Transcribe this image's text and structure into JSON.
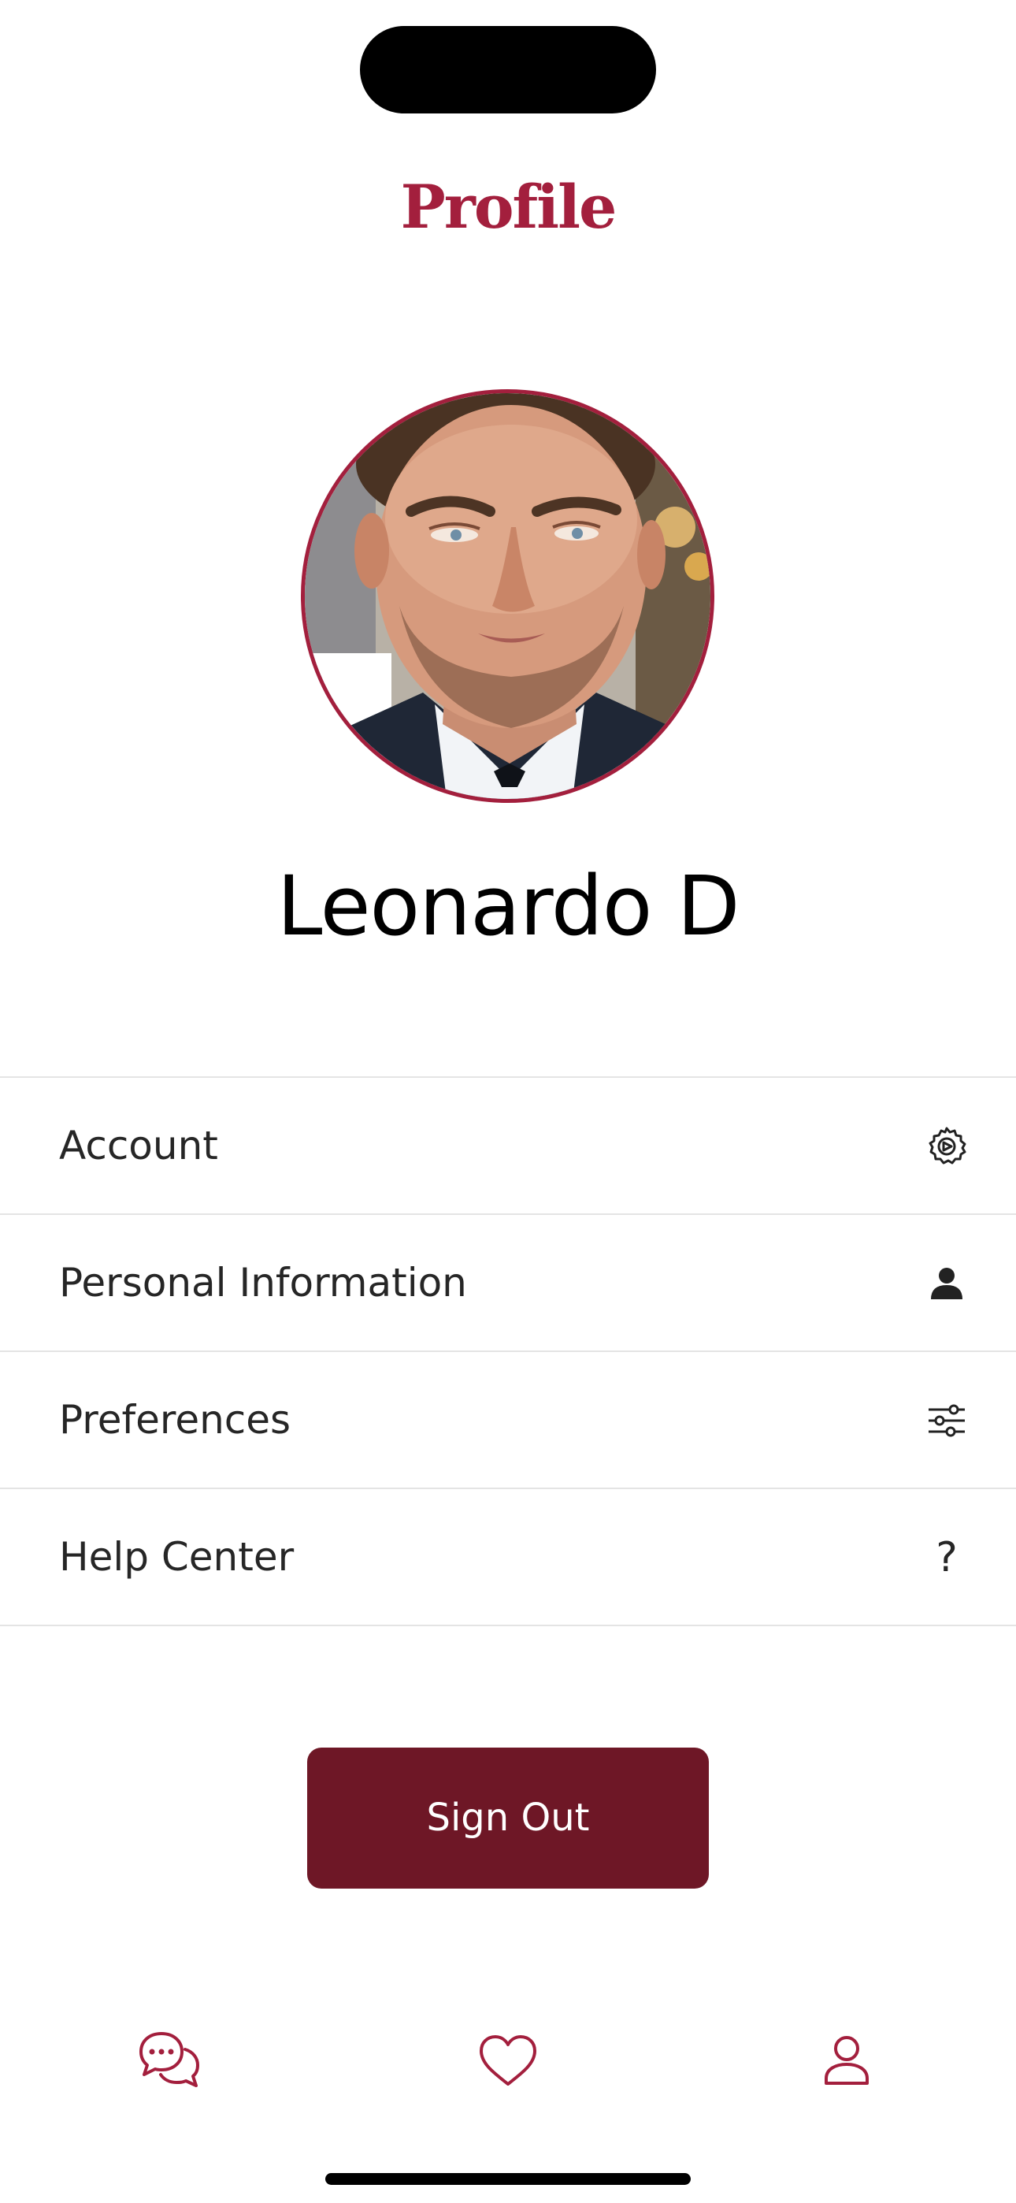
{
  "header": {
    "title": "Profile"
  },
  "profile": {
    "name": "Leonardo D"
  },
  "menu": {
    "items": [
      {
        "label": "Account",
        "icon": "gear-icon"
      },
      {
        "label": "Personal Information",
        "icon": "person-icon"
      },
      {
        "label": "Preferences",
        "icon": "sliders-icon"
      },
      {
        "label": "Help Center",
        "icon": "question-icon",
        "glyph": "?"
      }
    ]
  },
  "actions": {
    "sign_out_label": "Sign Out"
  },
  "tabbar": {
    "items": [
      {
        "name": "chat",
        "icon": "chat-bubbles-icon"
      },
      {
        "name": "favorites",
        "icon": "heart-icon"
      },
      {
        "name": "profile",
        "icon": "person-outline-icon"
      }
    ]
  },
  "colors": {
    "accent": "#a31f3d",
    "button": "#6e1726",
    "divider": "#e4e4e4"
  }
}
